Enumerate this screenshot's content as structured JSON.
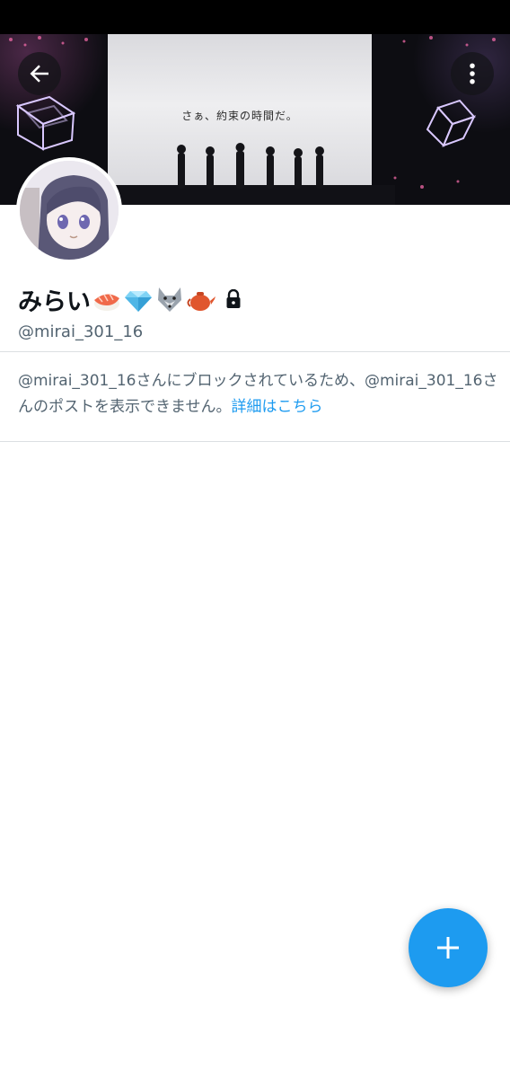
{
  "banner": {
    "screen_caption": "さぁ、約束の時間だ。"
  },
  "nav": {
    "back_icon": "arrow-left-icon",
    "more_icon": "more-vertical-icon"
  },
  "profile": {
    "display_name": "みらい",
    "name_emojis": [
      "sushi",
      "gem",
      "wolf",
      "teapot"
    ],
    "protected_icon": "lock-icon",
    "handle": "@mirai_301_16"
  },
  "blocked_notice": {
    "message": "@mirai_301_16さんにブロックされているため、@mirai_301_16さんのポストを表示できません。",
    "link_text": "詳細はこちら"
  },
  "compose": {
    "icon": "plus-icon"
  },
  "colors": {
    "accent": "#1d9bf0",
    "text_primary": "#0f1419",
    "text_secondary": "#536471"
  }
}
